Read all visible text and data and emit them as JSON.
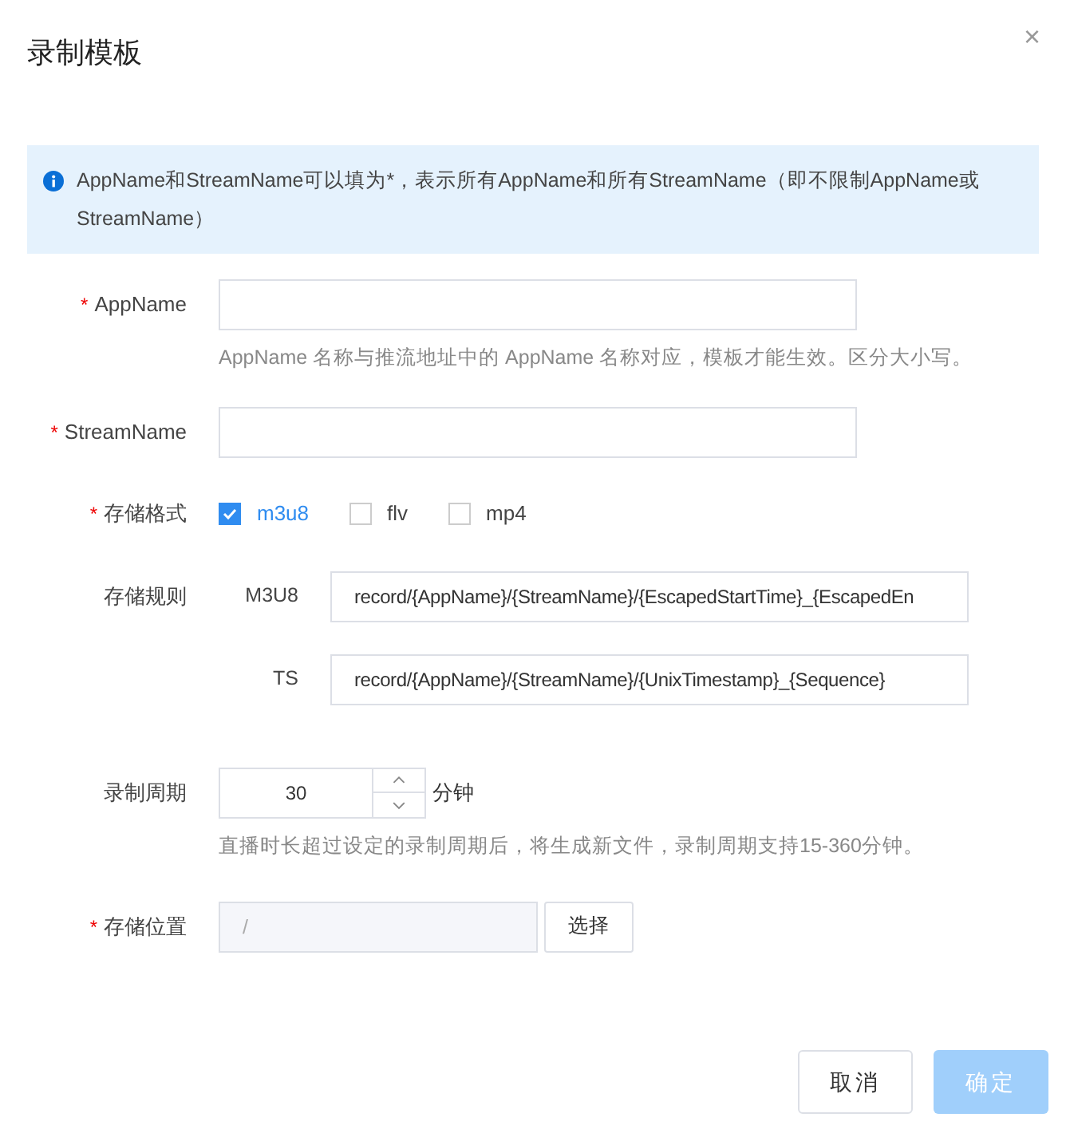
{
  "dialog": {
    "title": "录制模板",
    "close": "×"
  },
  "notice": "AppName和StreamName可以填为*，表示所有AppName和所有StreamName（即不限制AppName或StreamName）",
  "app_name": {
    "label": "AppName",
    "required_mark": "*",
    "hint": "AppName 名称与推流地址中的 AppName 名称对应，模板才能生效。区分大小写。"
  },
  "stream_name": {
    "label": "StreamName",
    "required_mark": "*"
  },
  "format": {
    "label": "存储格式",
    "required_mark": "*",
    "options": [
      {
        "label": "m3u8",
        "checked": true
      },
      {
        "label": "flv",
        "checked": false
      },
      {
        "label": "mp4",
        "checked": false
      }
    ]
  },
  "rules": {
    "label": "存储规则",
    "items": [
      {
        "label": "M3U8",
        "value": "record/{AppName}/{StreamName}/{EscapedStartTime}_{EscapedEn"
      },
      {
        "label": "TS",
        "value": "record/{AppName}/{StreamName}/{UnixTimestamp}_{Sequence}"
      }
    ]
  },
  "period": {
    "label": "录制周期",
    "value": "30",
    "unit": "分钟",
    "hint": "直播时长超过设定的录制周期后，将生成新文件，录制周期支持15-360分钟。"
  },
  "location": {
    "label": "存储位置",
    "required_mark": "*",
    "value": "/",
    "disabled": true,
    "button": "选择"
  },
  "buttons": [
    {
      "label": "取消",
      "kind": "default",
      "disabled": false
    },
    {
      "label": "确定",
      "kind": "primary",
      "disabled": true
    }
  ]
}
